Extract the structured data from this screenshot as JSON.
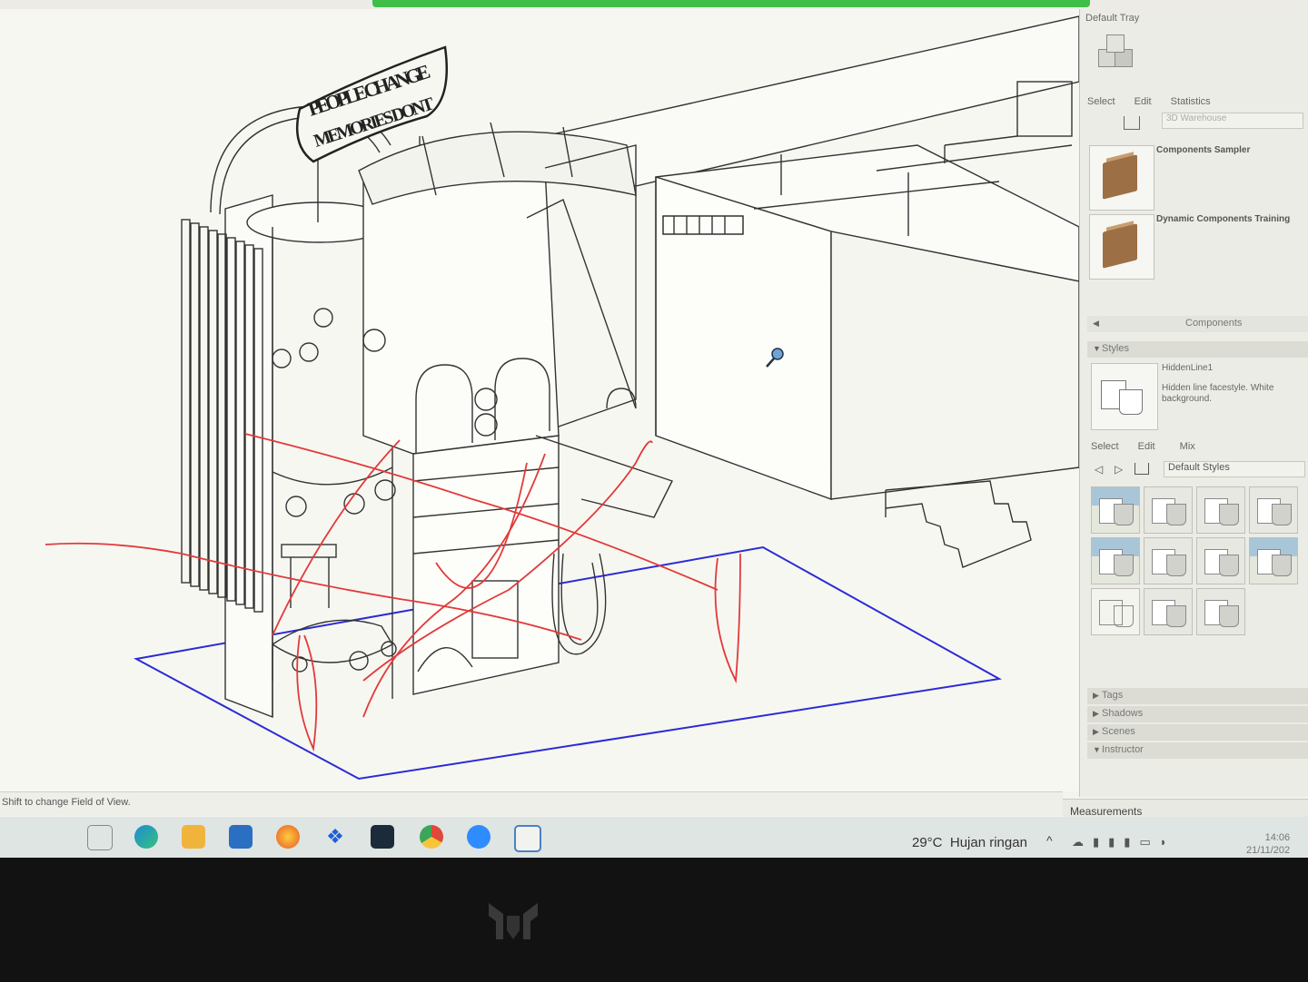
{
  "sign": {
    "line1": "PEOPLE CHANGE",
    "line2": "MEMORIES DONT"
  },
  "statusbar": {
    "hint": "Shift to change Field of View."
  },
  "measurements": {
    "label": "Measurements"
  },
  "tray": {
    "title": "Default Tray",
    "component_tabs": [
      "Select",
      "Edit",
      "Statistics"
    ],
    "search_placeholder": "3D Warehouse",
    "components": [
      {
        "label": "Components Sampler"
      },
      {
        "label": "Dynamic Components Training"
      }
    ],
    "components_panel_label": "Components",
    "styles": {
      "header": "Styles",
      "current_name": "HiddenLine1",
      "current_desc": "Hidden line facestyle. White background.",
      "tabs": [
        "Select",
        "Edit",
        "Mix"
      ],
      "collection": "Default Styles"
    },
    "collapsed_panels": [
      "Tags",
      "Shadows",
      "Scenes",
      "Instructor"
    ]
  },
  "taskbar": {
    "weather_temp": "29°C",
    "weather_text": "Hujan ringan",
    "time": "14:06",
    "date": "21/11/202"
  },
  "colors": {
    "accent_green": "#3fbf4a",
    "markup_red": "#e23a3a",
    "outline_blue": "#2b2bd6"
  }
}
